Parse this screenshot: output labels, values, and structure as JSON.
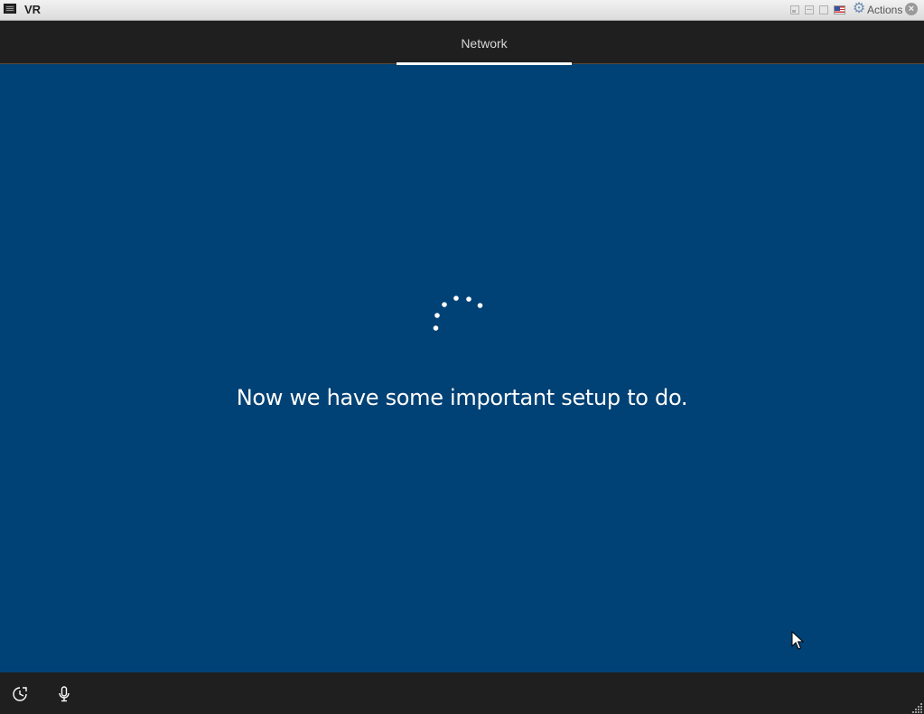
{
  "window": {
    "title": "VR",
    "actions_label": "Actions",
    "icons": [
      "app-icon",
      "minimize-icon",
      "restore-icon",
      "maximize-icon",
      "us-flag-icon",
      "gear-icon",
      "close-icon"
    ]
  },
  "header": {
    "tabs": [
      {
        "label": "Network",
        "active": true
      }
    ]
  },
  "main": {
    "message": "Now we have some important setup to do.",
    "spinner": "loading-dots-icon"
  },
  "footer": {
    "icons": [
      "ease-of-access-icon",
      "microphone-icon"
    ]
  },
  "colors": {
    "background": "#004275",
    "bar": "#1f1f1f",
    "text": "#ffffff"
  }
}
